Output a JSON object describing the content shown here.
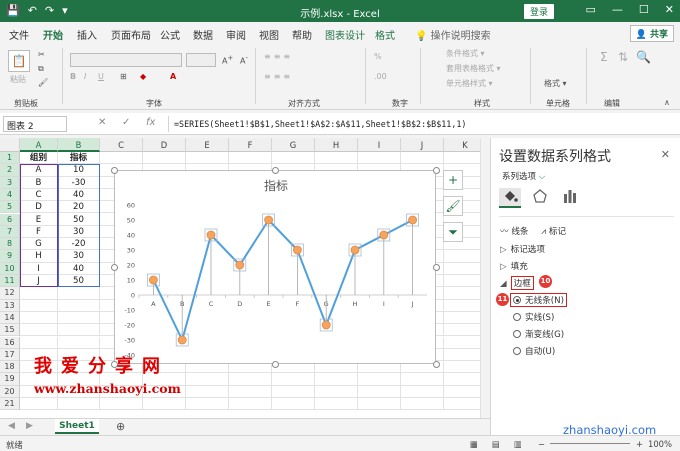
{
  "app": {
    "title": "示例.xlsx  -  Excel",
    "login": "登录",
    "share": "共享",
    "qat": [
      "💾",
      "↶",
      "↷",
      "▾"
    ],
    "window_controls": [
      "▭",
      "—",
      "☐",
      "✕"
    ]
  },
  "ribbon_tabs": [
    "文件",
    "开始",
    "插入",
    "页面布局",
    "公式",
    "数据",
    "审阅",
    "视图",
    "帮助",
    "图表设计",
    "格式",
    "操作说明搜索"
  ],
  "active_tab": "开始",
  "ribbon": {
    "groups": [
      "剪贴板",
      "字体",
      "对齐方式",
      "数字",
      "样式",
      "单元格",
      "编辑"
    ],
    "paste": "粘贴",
    "number_format": "数字",
    "styles": [
      "条件格式 ▾",
      "套用表格格式 ▾",
      "单元格样式 ▾"
    ],
    "cells": "单元格",
    "format": "格式 ▾"
  },
  "formula_bar": {
    "name_box": "图表 2",
    "fx": "fx",
    "formula": "=SERIES(Sheet1!$B$1,Sheet1!$A$2:$A$11,Sheet1!$B$2:$B$11,1)"
  },
  "columns": [
    "A",
    "B",
    "C",
    "D",
    "E",
    "F",
    "G",
    "H",
    "I",
    "J",
    "K"
  ],
  "rows": [
    "1",
    "2",
    "3",
    "4",
    "5",
    "6",
    "7",
    "8",
    "9",
    "10",
    "11",
    "12",
    "13",
    "14",
    "15",
    "16",
    "17",
    "18",
    "19",
    "20",
    "21"
  ],
  "table": {
    "headers": [
      "组别",
      "指标"
    ],
    "rows": [
      [
        "A",
        "10"
      ],
      [
        "B",
        "-30"
      ],
      [
        "C",
        "40"
      ],
      [
        "D",
        "20"
      ],
      [
        "E",
        "50"
      ],
      [
        "F",
        "30"
      ],
      [
        "G",
        "-20"
      ],
      [
        "H",
        "30"
      ],
      [
        "I",
        "40"
      ],
      [
        "J",
        "50"
      ]
    ]
  },
  "chart_data": {
    "type": "line",
    "title": "指标",
    "categories": [
      "A",
      "B",
      "C",
      "D",
      "E",
      "F",
      "G",
      "H",
      "I",
      "J"
    ],
    "values": [
      10,
      -30,
      40,
      20,
      50,
      30,
      -20,
      30,
      40,
      50
    ],
    "ylim": [
      -40,
      60
    ],
    "yticks": [
      "60",
      "50",
      "40",
      "30",
      "20",
      "10",
      "0",
      "-10",
      "-20",
      "-30",
      "-40"
    ],
    "line_color": "#4f9fdc",
    "marker_color": "#f4a460",
    "grid": false,
    "legend": "none"
  },
  "pane": {
    "title": "设置数据系列格式",
    "subtitle": "系列选项",
    "close": "✕",
    "sections": [
      "线条",
      "标记"
    ],
    "items": [
      "标记选项",
      "填充",
      "边框"
    ],
    "radios": [
      "无线条(N)",
      "实线(S)",
      "渐变线(G)",
      "自动(U)"
    ],
    "selected_radio": "无线条(N)",
    "badges": [
      "10",
      "11"
    ]
  },
  "sheet": {
    "tab": "Sheet1",
    "add": "⊕"
  },
  "status": {
    "left": "就绪",
    "zoom": "100%"
  },
  "watermark": {
    "cn": "我爱分享网",
    "url": "www.zhanshaoyi.com",
    "corner": "zhanshaoyi.com"
  },
  "colors": {
    "accent": "#217346",
    "red": "#d62020"
  }
}
